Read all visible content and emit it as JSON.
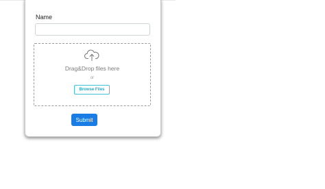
{
  "form": {
    "name_label": "Name",
    "name_value": "",
    "name_placeholder": ""
  },
  "dropzone": {
    "icon": "cloud-upload-icon",
    "text": "Drag&Drop files here",
    "or_text": "or",
    "browse_label": "Browse Files"
  },
  "submit_label": "Submit",
  "colors": {
    "submit": "#1a7de6",
    "browse_border": "#3fc2d8"
  }
}
